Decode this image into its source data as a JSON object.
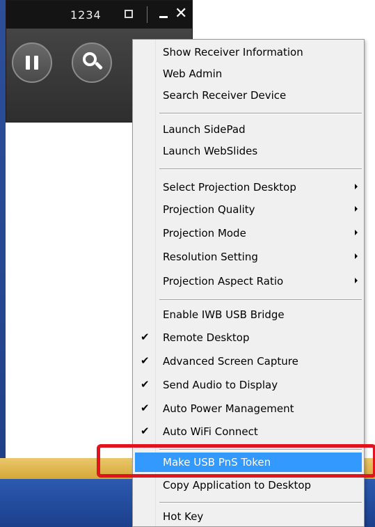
{
  "window": {
    "room_code": "1234"
  },
  "icons": {
    "dock": "dock-icon",
    "minimize": "minimize-icon",
    "close": "close-icon",
    "pause": "pause-icon",
    "search": "search-icon",
    "check": "checkmark-icon",
    "submenu": "submenu-arrow-icon"
  },
  "colors": {
    "highlight": "#3399ff",
    "annotation": "#e0141e"
  },
  "menu": {
    "items": [
      {
        "label": "Show Receiver Information",
        "checked": false,
        "submenu": false,
        "highlighted": false
      },
      {
        "label": "Web Admin",
        "checked": false,
        "submenu": false,
        "highlighted": false
      },
      {
        "label": "Search Receiver Device",
        "checked": false,
        "submenu": false,
        "highlighted": false
      },
      {
        "label": "Launch SidePad",
        "checked": false,
        "submenu": false,
        "highlighted": false
      },
      {
        "label": "Launch WebSlides",
        "checked": false,
        "submenu": false,
        "highlighted": false
      },
      {
        "label": "Select Projection Desktop",
        "checked": false,
        "submenu": true,
        "highlighted": false
      },
      {
        "label": "Projection Quality",
        "checked": false,
        "submenu": true,
        "highlighted": false
      },
      {
        "label": "Projection Mode",
        "checked": false,
        "submenu": true,
        "highlighted": false
      },
      {
        "label": "Resolution Setting",
        "checked": false,
        "submenu": true,
        "highlighted": false
      },
      {
        "label": "Projection Aspect Ratio",
        "checked": false,
        "submenu": true,
        "highlighted": false
      },
      {
        "label": "Enable IWB USB Bridge",
        "checked": false,
        "submenu": false,
        "highlighted": false
      },
      {
        "label": "Remote Desktop",
        "checked": true,
        "submenu": false,
        "highlighted": false
      },
      {
        "label": "Advanced Screen Capture",
        "checked": true,
        "submenu": false,
        "highlighted": false
      },
      {
        "label": "Send Audio to Display",
        "checked": true,
        "submenu": false,
        "highlighted": false
      },
      {
        "label": "Auto Power Management",
        "checked": true,
        "submenu": false,
        "highlighted": false
      },
      {
        "label": "Auto WiFi Connect",
        "checked": true,
        "submenu": false,
        "highlighted": false
      },
      {
        "label": "Make USB PnS Token",
        "checked": false,
        "submenu": false,
        "highlighted": true
      },
      {
        "label": "Copy Application to Desktop",
        "checked": false,
        "submenu": false,
        "highlighted": false
      },
      {
        "label": "Hot Key",
        "checked": false,
        "submenu": false,
        "highlighted": false
      }
    ]
  }
}
